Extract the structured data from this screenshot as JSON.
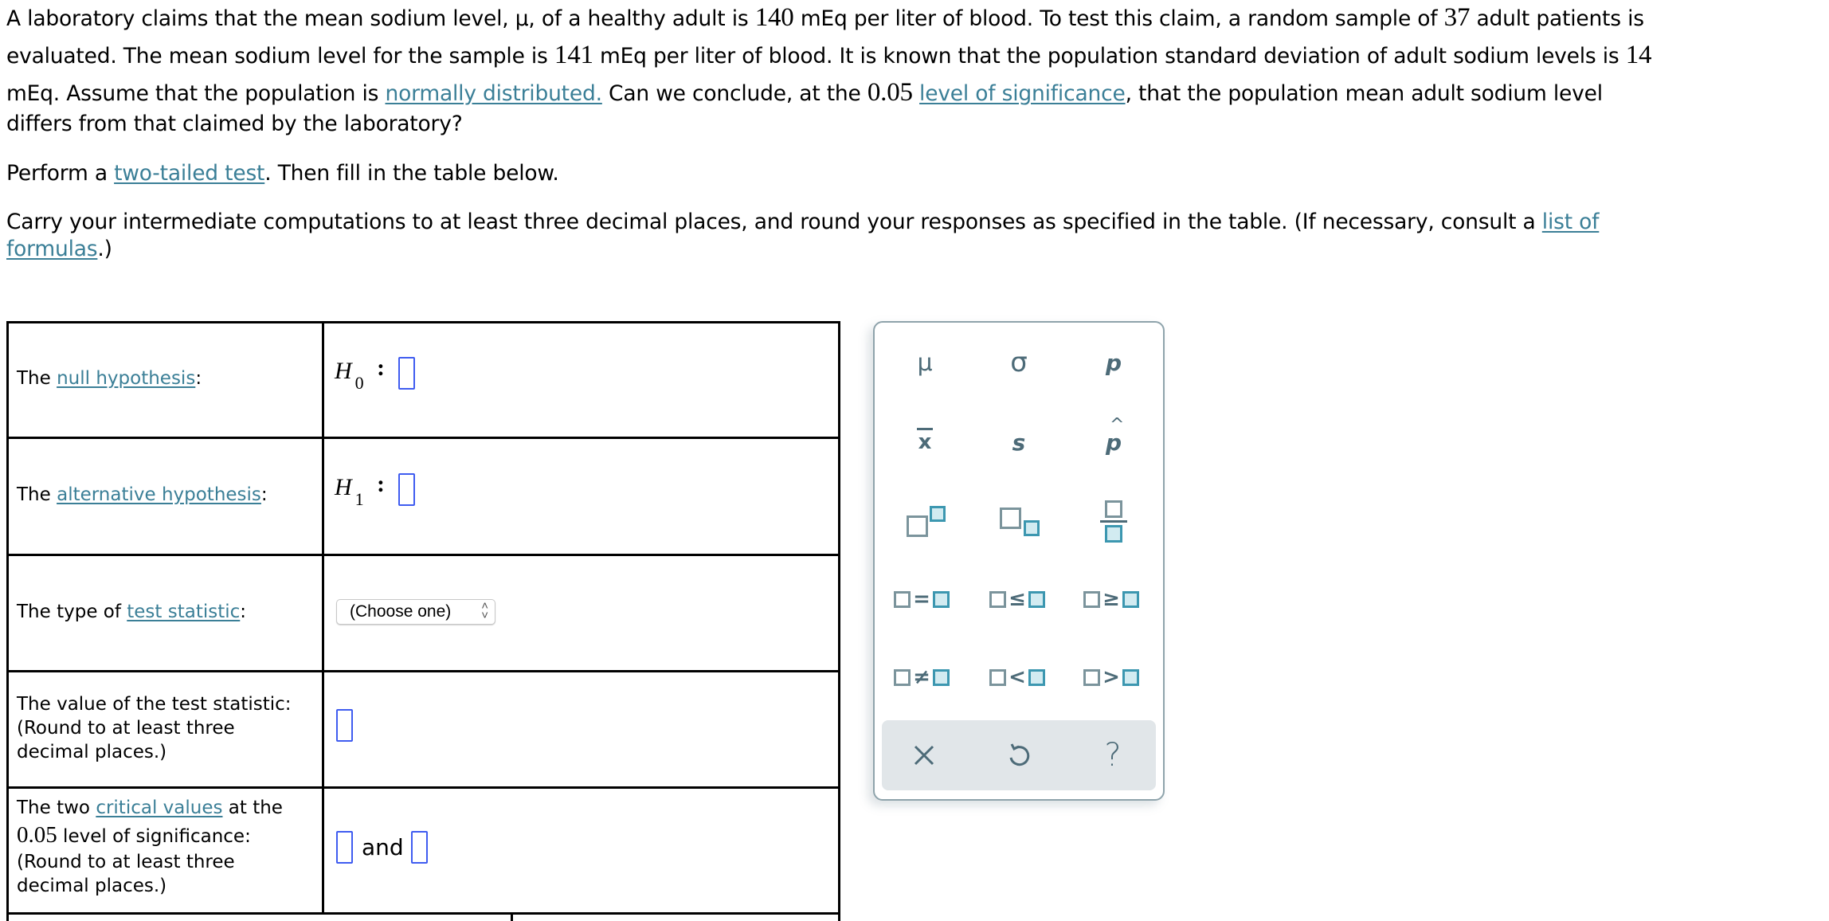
{
  "problem": {
    "lines": [
      [
        "A laboratory claims that the mean sodium level, μ, of a healthy adult is ",
        {
          "num": "140"
        },
        " mEq per liter of blood. To test this claim, a random sample of ",
        {
          "num": "37"
        },
        " adult patients is"
      ],
      [
        "evaluated. The mean sodium level for the sample is ",
        {
          "num": "141"
        },
        " mEq per liter of blood. It is known that the population standard deviation of adult sodium levels is ",
        {
          "num": "14"
        }
      ],
      [
        "mEq. Assume that the population is ",
        {
          "link": "normally distributed."
        },
        " Can we conclude, at the ",
        {
          "num": "0.05"
        },
        " ",
        {
          "link": "level of significance"
        },
        ", that the population mean adult sodium level"
      ],
      [
        "differs from that claimed by the laboratory?"
      ]
    ]
  },
  "instruction1": {
    "prefix": "Perform a ",
    "link": "two-tailed test",
    "suffix": ". Then fill in the table below."
  },
  "instruction2": {
    "line1_text": "Carry your intermediate computations to at least three decimal places, and round your responses as specified in the table. (If necessary, consult a ",
    "line1_link": "list of",
    "line2_link": "formulas",
    "line2_suffix": ".)"
  },
  "table": {
    "null_hypothesis": {
      "prefix": "The ",
      "link": "null hypothesis",
      "suffix": ":",
      "symbol": "H",
      "subscript": "0",
      "colon": ":"
    },
    "alternative_hypothesis": {
      "prefix": "The ",
      "link": "alternative hypothesis",
      "suffix": ":",
      "symbol": "H",
      "subscript": "1",
      "colon": ":"
    },
    "test_statistic_type": {
      "prefix": "The type of ",
      "link": "test statistic",
      "suffix": ":",
      "select_value": "(Choose one)"
    },
    "test_statistic_value": {
      "line1": "The value of the test statistic:",
      "line2": "(Round to at least three",
      "line3": "decimal places.)"
    },
    "critical_values": {
      "prefix": "The two ",
      "link": "critical values",
      "suffix": " at the",
      "alpha": "0.05",
      "alpha_suffix": " level of significance:",
      "line3": "(Round to at least three",
      "line4": "decimal places.)",
      "and_text": "and"
    }
  },
  "keypad": {
    "symbols": [
      {
        "name": "mu",
        "glyph": "μ"
      },
      {
        "name": "sigma",
        "glyph": "σ"
      },
      {
        "name": "p",
        "glyph": "p"
      },
      {
        "name": "x-bar",
        "glyph": "x"
      },
      {
        "name": "s",
        "glyph": "s"
      },
      {
        "name": "p-hat",
        "glyph": "p",
        "hat": "^"
      }
    ],
    "relations": [
      {
        "name": "equals",
        "op": "="
      },
      {
        "name": "less-equal",
        "op": "≤"
      },
      {
        "name": "greater-equal",
        "op": "≥"
      },
      {
        "name": "not-equal",
        "op": "≠"
      },
      {
        "name": "less-than",
        "op": "<"
      },
      {
        "name": "greater-than",
        "op": ">"
      }
    ],
    "footer": {
      "clear": "×",
      "undo": "↺",
      "help": "?"
    }
  }
}
